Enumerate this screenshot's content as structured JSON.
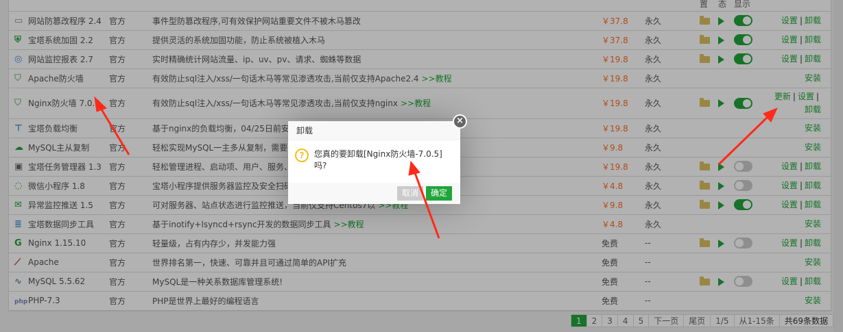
{
  "header": {
    "loc": "置",
    "status": "态",
    "show": "显示"
  },
  "rows": [
    {
      "name": "网站防篡改程序 2.4",
      "type": "官方",
      "desc": "事件型防篡改程序,可有效保护网站重要文件不被木马篡改",
      "tut": "",
      "price": "￥37.8",
      "expire": "永久",
      "installed": true,
      "show": true,
      "ops": [
        "设置",
        "卸载"
      ],
      "icon": "lock-window-icon",
      "color": "#888"
    },
    {
      "name": "宝塔系统加固 2.2",
      "type": "官方",
      "desc": "提供灵活的系统加固功能，防止系统被植入木马",
      "tut": "",
      "price": "￥37.8",
      "expire": "永久",
      "installed": true,
      "show": true,
      "ops": [
        "设置",
        "卸载"
      ],
      "icon": "shield-plus-icon",
      "color": "#20a53a"
    },
    {
      "name": "网站监控报表 2.7",
      "type": "官方",
      "desc": "实时精确统计网站流量、ip、uv、pv、请求、蜘蛛等数据",
      "tut": "",
      "price": "￥19.8",
      "expire": "永久",
      "installed": true,
      "show": true,
      "ops": [
        "设置",
        "卸载"
      ],
      "icon": "globe-icon",
      "color": "#4a90d9"
    },
    {
      "name": "Apache防火墙",
      "type": "官方",
      "desc": "有效防止sql注入/xss/一句话木马等常见渗透攻击,当前仅支持Apache2.4",
      "tut": ">>教程",
      "price": "￥19.8",
      "expire": "永久",
      "installed": false,
      "show": false,
      "ops": [
        "安装"
      ],
      "icon": "waf-shield-icon",
      "color": "#8bc48b"
    },
    {
      "name": "Nginx防火墙 7.0.3",
      "type": "官方",
      "desc": "有效防止sql注入/xss/一句话木马等常见渗透攻击,当前仅支持nginx",
      "tut": ">>教程",
      "price": "￥19.8",
      "expire": "永久",
      "installed": true,
      "show": true,
      "ops": [
        "更新",
        "设置",
        "卸载"
      ],
      "icon": "waf-shield-icon",
      "color": "#8bc48b"
    },
    {
      "name": "宝塔负载均衡",
      "type": "官方",
      "desc": "基于nginx的负载均衡，04/25日前安装",
      "tut": "",
      "price": "￥19.8",
      "expire": "永久",
      "installed": false,
      "show": false,
      "ops": [
        "安装"
      ],
      "icon": "network-icon",
      "color": "#4a90d9"
    },
    {
      "name": "MySQL主从复制",
      "type": "官方",
      "desc": "轻松实现MySQL一主多从复制，需要",
      "tut": "",
      "price": "￥9.8",
      "expire": "永久",
      "installed": false,
      "show": false,
      "ops": [
        "安装"
      ],
      "icon": "cloud-sync-icon",
      "color": "#20a53a"
    },
    {
      "name": "宝塔任务管理器 1.3",
      "type": "官方",
      "desc": "轻松管理进程、启动项、用户、服务、",
      "tut": "",
      "price": "￥19.8",
      "expire": "永久",
      "installed": true,
      "show": false,
      "ops": [
        "设置",
        "卸载"
      ],
      "icon": "monitor-icon",
      "color": "#666"
    },
    {
      "name": "微信小程序 1.8",
      "type": "官方",
      "desc": "宝塔小程序提供服务器监控及安全扫码",
      "tut": "",
      "price": "￥4.8",
      "expire": "永久",
      "installed": true,
      "show": false,
      "ops": [
        "设置",
        "卸载"
      ],
      "icon": "wechat-link-icon",
      "color": "#20a53a"
    },
    {
      "name": "异常监控推送 1.5",
      "type": "官方",
      "desc": "可对服务器、站点状态进行监控推送，当前仅支持Centos7以",
      "tut": ">>教程",
      "price": "￥9.8",
      "expire": "永久",
      "installed": true,
      "show": true,
      "ops": [
        "设置",
        "卸载"
      ],
      "icon": "mail-icon",
      "color": "#20a53a"
    },
    {
      "name": "宝塔数据同步工具",
      "type": "官方",
      "desc": "基于inotify+lsyncd+rsync开发的数据同步工具",
      "tut": ">>教程",
      "price": "￥4.8",
      "expire": "永久",
      "installed": false,
      "show": false,
      "ops": [
        "安装"
      ],
      "icon": "database-icon",
      "color": "#4a90d9"
    },
    {
      "name": "Nginx 1.15.10",
      "type": "官方",
      "desc": "轻量级，占有内存少，并发能力强",
      "tut": "",
      "price": "免费",
      "expire": "--",
      "installed": true,
      "show": false,
      "ops": [
        "设置",
        "卸载"
      ],
      "icon": "nginx-g-icon",
      "color": "#20a53a"
    },
    {
      "name": "Apache",
      "type": "官方",
      "desc": "世界排名第一，快速、可靠并且可通过简单的API扩充",
      "tut": "",
      "price": "免费",
      "expire": "--",
      "installed": false,
      "show": false,
      "ops": [
        "安装"
      ],
      "icon": "apache-feather-icon",
      "color": "#c03030"
    },
    {
      "name": "MySQL 5.5.62",
      "type": "官方",
      "desc": "MySQL是一种关系数据库管理系统!",
      "tut": "",
      "price": "免费",
      "expire": "--",
      "installed": true,
      "show": false,
      "ops": [
        "设置",
        "卸载"
      ],
      "icon": "mysql-dolphin-icon",
      "color": "#6a8caf"
    },
    {
      "name": "PHP-7.3",
      "type": "官方",
      "desc": "PHP是世界上最好的编程语言",
      "tut": "",
      "price": "免费",
      "expire": "--",
      "installed": false,
      "show": false,
      "ops": [
        "安装"
      ],
      "icon": "php-icon",
      "color": "#7a86b8"
    }
  ],
  "pager": {
    "pages": [
      "1",
      "2",
      "3",
      "4",
      "5"
    ],
    "next": "下一页",
    "last": "尾页",
    "page_of": "1/5",
    "range": "从1-15条",
    "total": "共69条数据"
  },
  "dialog": {
    "title": "卸载",
    "message": "您真的要卸载[Nginx防火墙-7.0.5]吗?",
    "cancel": "取消",
    "confirm": "确定",
    "icon": "question-icon"
  },
  "colors": {
    "accent": "#20a53a",
    "price": "#fc6d26",
    "annotation_arrow": "#ff2a1a"
  }
}
